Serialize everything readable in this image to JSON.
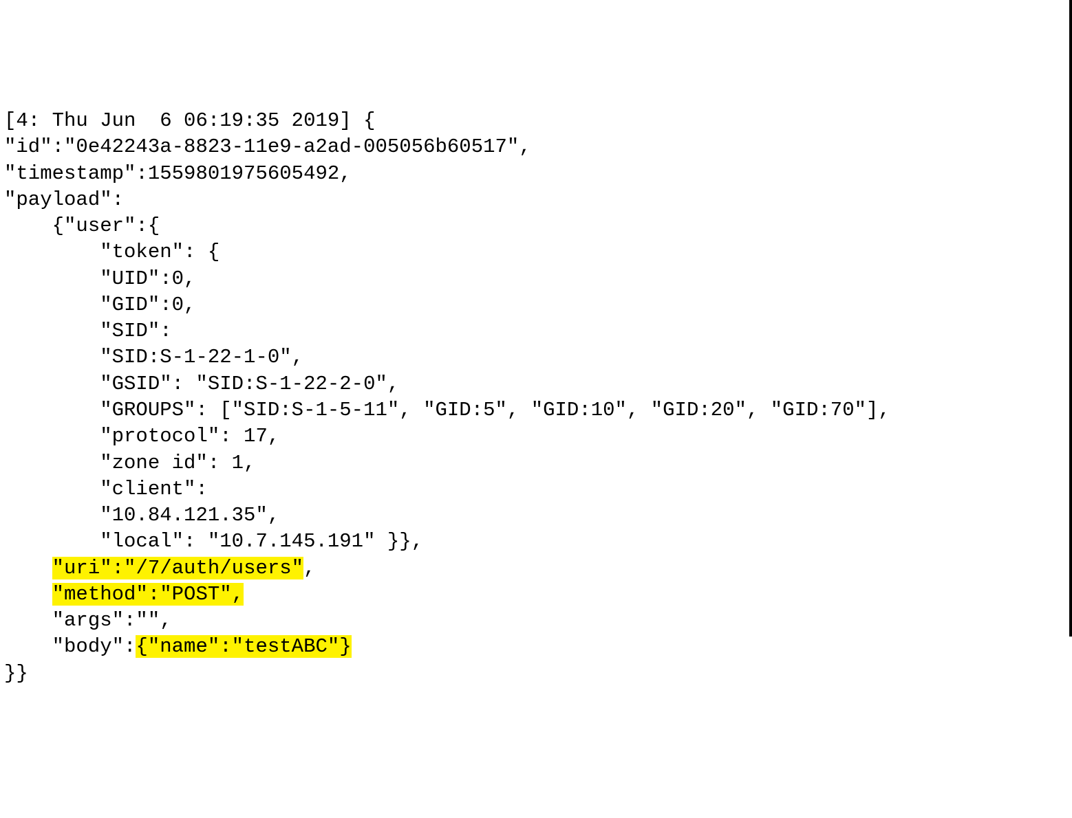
{
  "line1": "[4: Thu Jun  6 06:19:35 2019] {",
  "line2": "\"id\":\"0e42243a-8823-11e9-a2ad-005056b60517\",",
  "line3": "\"timestamp\":1559801975605492,",
  "line4": "\"payload\":",
  "line5": "    {\"user\":{",
  "line6": "        \"token\": {",
  "line7": "        \"UID\":0,",
  "line8": "        \"GID\":0,",
  "line9": "        \"SID\":",
  "line10": "        \"SID:S-1-22-1-0\",",
  "line11": "        \"GSID\": \"SID:S-1-22-2-0\",",
  "line12": "        \"GROUPS\": [\"SID:S-1-5-11\", \"GID:5\", \"GID:10\", \"GID:20\", \"GID:70\"],",
  "line13": "        \"protocol\": 17,",
  "line14": "        \"zone id\": 1,",
  "line15": "        \"client\":",
  "line16": "        \"10.84.121.35\",",
  "line17": "        \"local\": \"10.7.145.191\" }},",
  "line18_prefix": "    ",
  "line18_hl": "\"uri\":\"/7/auth/users\"",
  "line18_suffix": ",",
  "line19_prefix": "    ",
  "line19_hl": "\"method\":\"POST\",",
  "line20": "    \"args\":\"\",",
  "line21_prefix": "    \"body\":",
  "line21_hl": "{\"name\":\"testABC\"}",
  "line22": "}}"
}
